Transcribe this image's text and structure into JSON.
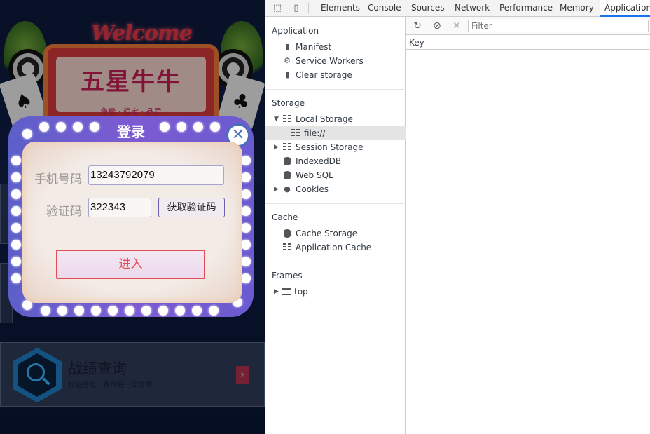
{
  "phone": {
    "welcome": "Welcome",
    "brand_title": "五星牛牛",
    "brand_sub": "免费 · 稳定 · 品质",
    "card_suit_left": "♠",
    "card_suit_right": "♣",
    "menu": {
      "title": "战绩查询",
      "desc": "根据房号，查询每一局详情",
      "arrow": "›"
    }
  },
  "login": {
    "title": "登录",
    "close_label": "✕",
    "phone_label": "手机号码",
    "phone_value": "13243792079",
    "code_label": "验证码",
    "code_value": "322343",
    "get_code_label": "获取验证码",
    "enter_label": "进入"
  },
  "devtools": {
    "tabs": [
      "Elements",
      "Console",
      "Sources",
      "Network",
      "Performance",
      "Memory",
      "Application"
    ],
    "active_tab": "Application",
    "sidebar": {
      "application": {
        "title": "Application",
        "items": [
          "Manifest",
          "Service Workers",
          "Clear storage"
        ]
      },
      "storage": {
        "title": "Storage",
        "local_storage": "Local Storage",
        "local_storage_child": "file://",
        "session_storage": "Session Storage",
        "indexeddb": "IndexedDB",
        "websql": "Web SQL",
        "cookies": "Cookies"
      },
      "cache": {
        "title": "Cache",
        "items": [
          "Cache Storage",
          "Application Cache"
        ]
      },
      "frames": {
        "title": "Frames",
        "top": "top"
      }
    },
    "main": {
      "filter_placeholder": "Filter",
      "column_key": "Key"
    },
    "icons": {
      "inspect": "⬚",
      "device": "▯",
      "refresh": "↻",
      "clear": "⊘",
      "delete": "✕"
    }
  }
}
